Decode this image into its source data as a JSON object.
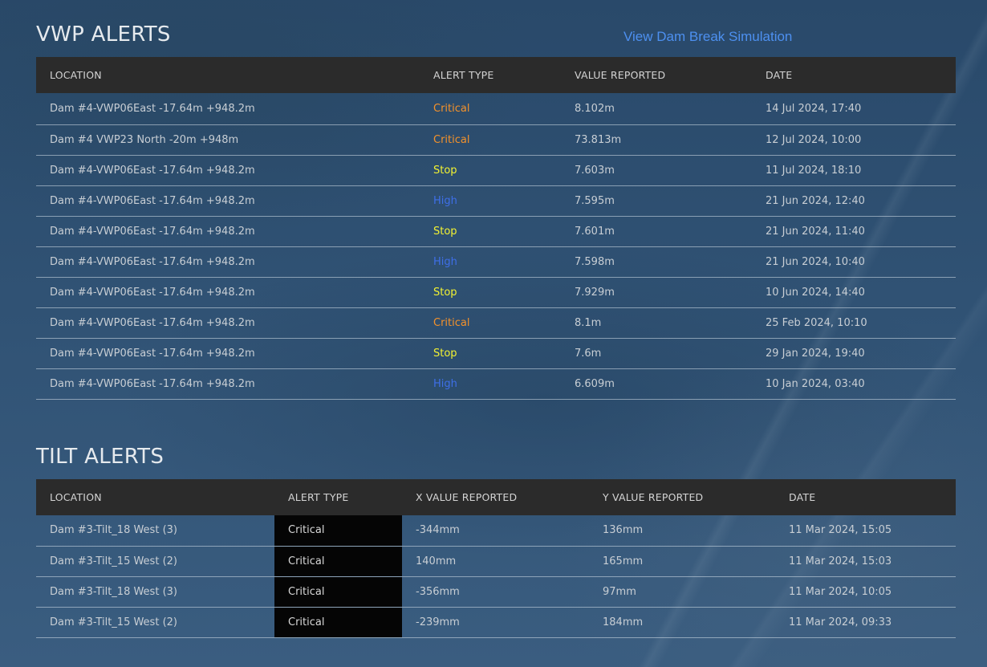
{
  "vwp": {
    "title": "VWP ALERTS",
    "simulation_link": "View Dam Break Simulation",
    "headers": [
      "LOCATION",
      "ALERT TYPE",
      "VALUE REPORTED",
      "DATE"
    ],
    "rows": [
      {
        "location": "Dam #4-VWP06East -17.64m +948.2m",
        "alert": "Critical",
        "value": "8.102m",
        "date": "14 Jul 2024, 17:40"
      },
      {
        "location": "Dam #4 VWP23 North -20m +948m",
        "alert": "Critical",
        "value": "73.813m",
        "date": "12 Jul 2024, 10:00"
      },
      {
        "location": "Dam #4-VWP06East -17.64m +948.2m",
        "alert": "Stop",
        "value": "7.603m",
        "date": "11 Jul 2024, 18:10"
      },
      {
        "location": "Dam #4-VWP06East -17.64m +948.2m",
        "alert": "High",
        "value": "7.595m",
        "date": "21 Jun 2024, 12:40"
      },
      {
        "location": "Dam #4-VWP06East -17.64m +948.2m",
        "alert": "Stop",
        "value": "7.601m",
        "date": "21 Jun 2024, 11:40"
      },
      {
        "location": "Dam #4-VWP06East -17.64m +948.2m",
        "alert": "High",
        "value": "7.598m",
        "date": "21 Jun 2024, 10:40"
      },
      {
        "location": "Dam #4-VWP06East -17.64m +948.2m",
        "alert": "Stop",
        "value": "7.929m",
        "date": "10 Jun 2024, 14:40"
      },
      {
        "location": "Dam #4-VWP06East -17.64m +948.2m",
        "alert": "Critical",
        "value": "8.1m",
        "date": "25 Feb 2024, 10:10"
      },
      {
        "location": "Dam #4-VWP06East -17.64m +948.2m",
        "alert": "Stop",
        "value": "7.6m",
        "date": "29 Jan 2024, 19:40"
      },
      {
        "location": "Dam #4-VWP06East -17.64m +948.2m",
        "alert": "High",
        "value": "6.609m",
        "date": "10 Jan 2024, 03:40"
      }
    ]
  },
  "tilt": {
    "title": "TILT ALERTS",
    "headers": [
      "LOCATION",
      "ALERT TYPE",
      "X VALUE REPORTED",
      "Y VALUE REPORTED",
      "DATE"
    ],
    "rows": [
      {
        "location": "Dam #3-Tilt_18 West (3)",
        "alert": "Critical",
        "x": "-344mm",
        "y": "136mm",
        "date": "11 Mar 2024, 15:05"
      },
      {
        "location": "Dam #3-Tilt_15 West (2)",
        "alert": "Critical",
        "x": "140mm",
        "y": "165mm",
        "date": "11 Mar 2024, 15:03"
      },
      {
        "location": "Dam #3-Tilt_18 West (3)",
        "alert": "Critical",
        "x": "-356mm",
        "y": "97mm",
        "date": "11 Mar 2024, 10:05"
      },
      {
        "location": "Dam #3-Tilt_15 West (2)",
        "alert": "Critical",
        "x": "-239mm",
        "y": "184mm",
        "date": "11 Mar 2024, 09:33"
      }
    ]
  },
  "colors": {
    "critical": "#f5922a",
    "stop": "#f2f232",
    "high": "#3e6fe8",
    "link": "#4d90f0",
    "header_bg": "#2b2b2b",
    "tilt_alert_bg": "#050505"
  }
}
